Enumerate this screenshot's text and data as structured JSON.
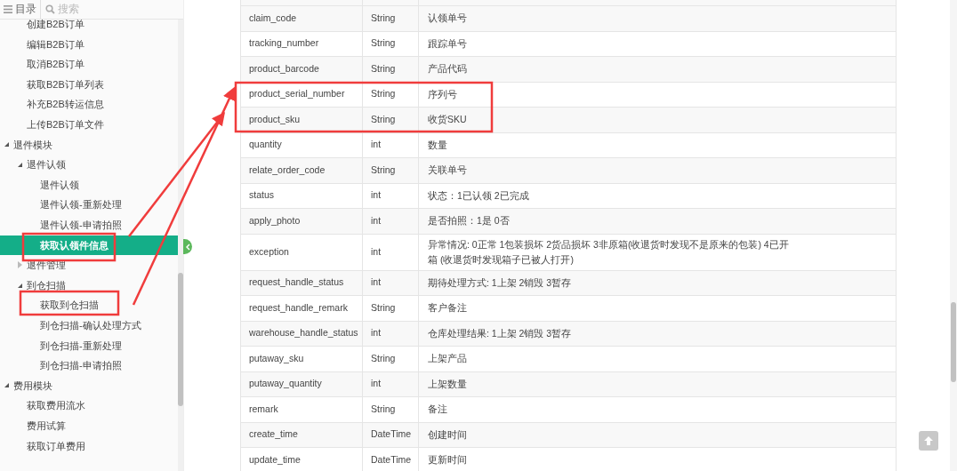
{
  "sidebar": {
    "toc_label": "目录",
    "search": {
      "placeholder": "搜索"
    },
    "tree": [
      {
        "children": [
          {
            "label": "创建B2B订单",
            "selected": false
          },
          {
            "label": "编辑B2B订单",
            "selected": false
          },
          {
            "label": "取消B2B订单",
            "selected": false
          },
          {
            "label": "获取B2B订单列表",
            "selected": false
          },
          {
            "label": "补充B2B转运信息",
            "selected": false
          },
          {
            "label": "上传B2B订单文件",
            "selected": false
          }
        ]
      },
      {
        "label": "退件模块",
        "expanded": true,
        "selected": false,
        "children": [
          {
            "label": "退件认领",
            "expanded": true,
            "selected": false,
            "children": [
              {
                "label": "退件认领",
                "selected": false
              },
              {
                "label": "退件认领-重新处理",
                "selected": false
              },
              {
                "label": "退件认领-申请拍照",
                "selected": false
              },
              {
                "label": "获取认领件信息",
                "selected": true
              }
            ]
          },
          {
            "label": "退件管理",
            "expanded": false,
            "selected": false
          },
          {
            "label": "到仓扫描",
            "expanded": true,
            "selected": false,
            "children": [
              {
                "label": "获取到仓扫描",
                "selected": false
              },
              {
                "label": "到仓扫描-确认处理方式",
                "selected": false
              },
              {
                "label": "到仓扫描-重新处理",
                "selected": false
              },
              {
                "label": "到仓扫描-申请拍照",
                "selected": false
              }
            ]
          }
        ]
      },
      {
        "label": "费用模块",
        "expanded": true,
        "selected": false,
        "children": [
          {
            "label": "获取费用流水",
            "selected": false
          },
          {
            "label": "费用试算",
            "selected": false
          },
          {
            "label": "获取订单费用",
            "selected": false
          }
        ]
      }
    ]
  },
  "table": {
    "rows": [
      [
        "claim_code",
        "String",
        "认领单号"
      ],
      [
        "tracking_number",
        "String",
        "跟踪单号"
      ],
      [
        "product_barcode",
        "String",
        "产品代码"
      ],
      [
        "product_serial_number",
        "String",
        "序列号"
      ],
      [
        "product_sku",
        "String",
        "收货SKU"
      ],
      [
        "quantity",
        "int",
        "数量"
      ],
      [
        "relate_order_code",
        "String",
        "关联单号"
      ],
      [
        "status",
        "int",
        "状态：1已认领 2已完成"
      ],
      [
        "apply_photo",
        "int",
        "是否拍照：1是 0否"
      ],
      [
        "exception",
        "int",
        "异常情况: 0正常 1包装损坏 2货品损坏 3非原箱(收退货时发现不是原来的包装) 4已开箱 (收退货时发现箱子已被人打开)"
      ],
      [
        "request_handle_status",
        "int",
        "期待处理方式: 1上架 2销毁 3暂存"
      ],
      [
        "request_handle_remark",
        "String",
        "客户备注"
      ],
      [
        "warehouse_handle_status",
        "int",
        "仓库处理结果: 1上架 2销毁 3暂存"
      ],
      [
        "putaway_sku",
        "String",
        "上架产品"
      ],
      [
        "putaway_quantity",
        "int",
        "上架数量"
      ],
      [
        "remark",
        "String",
        "备注"
      ],
      [
        "create_time",
        "DateTime",
        "创建时间"
      ],
      [
        "update_time",
        "DateTime",
        "更新时间"
      ]
    ]
  }
}
